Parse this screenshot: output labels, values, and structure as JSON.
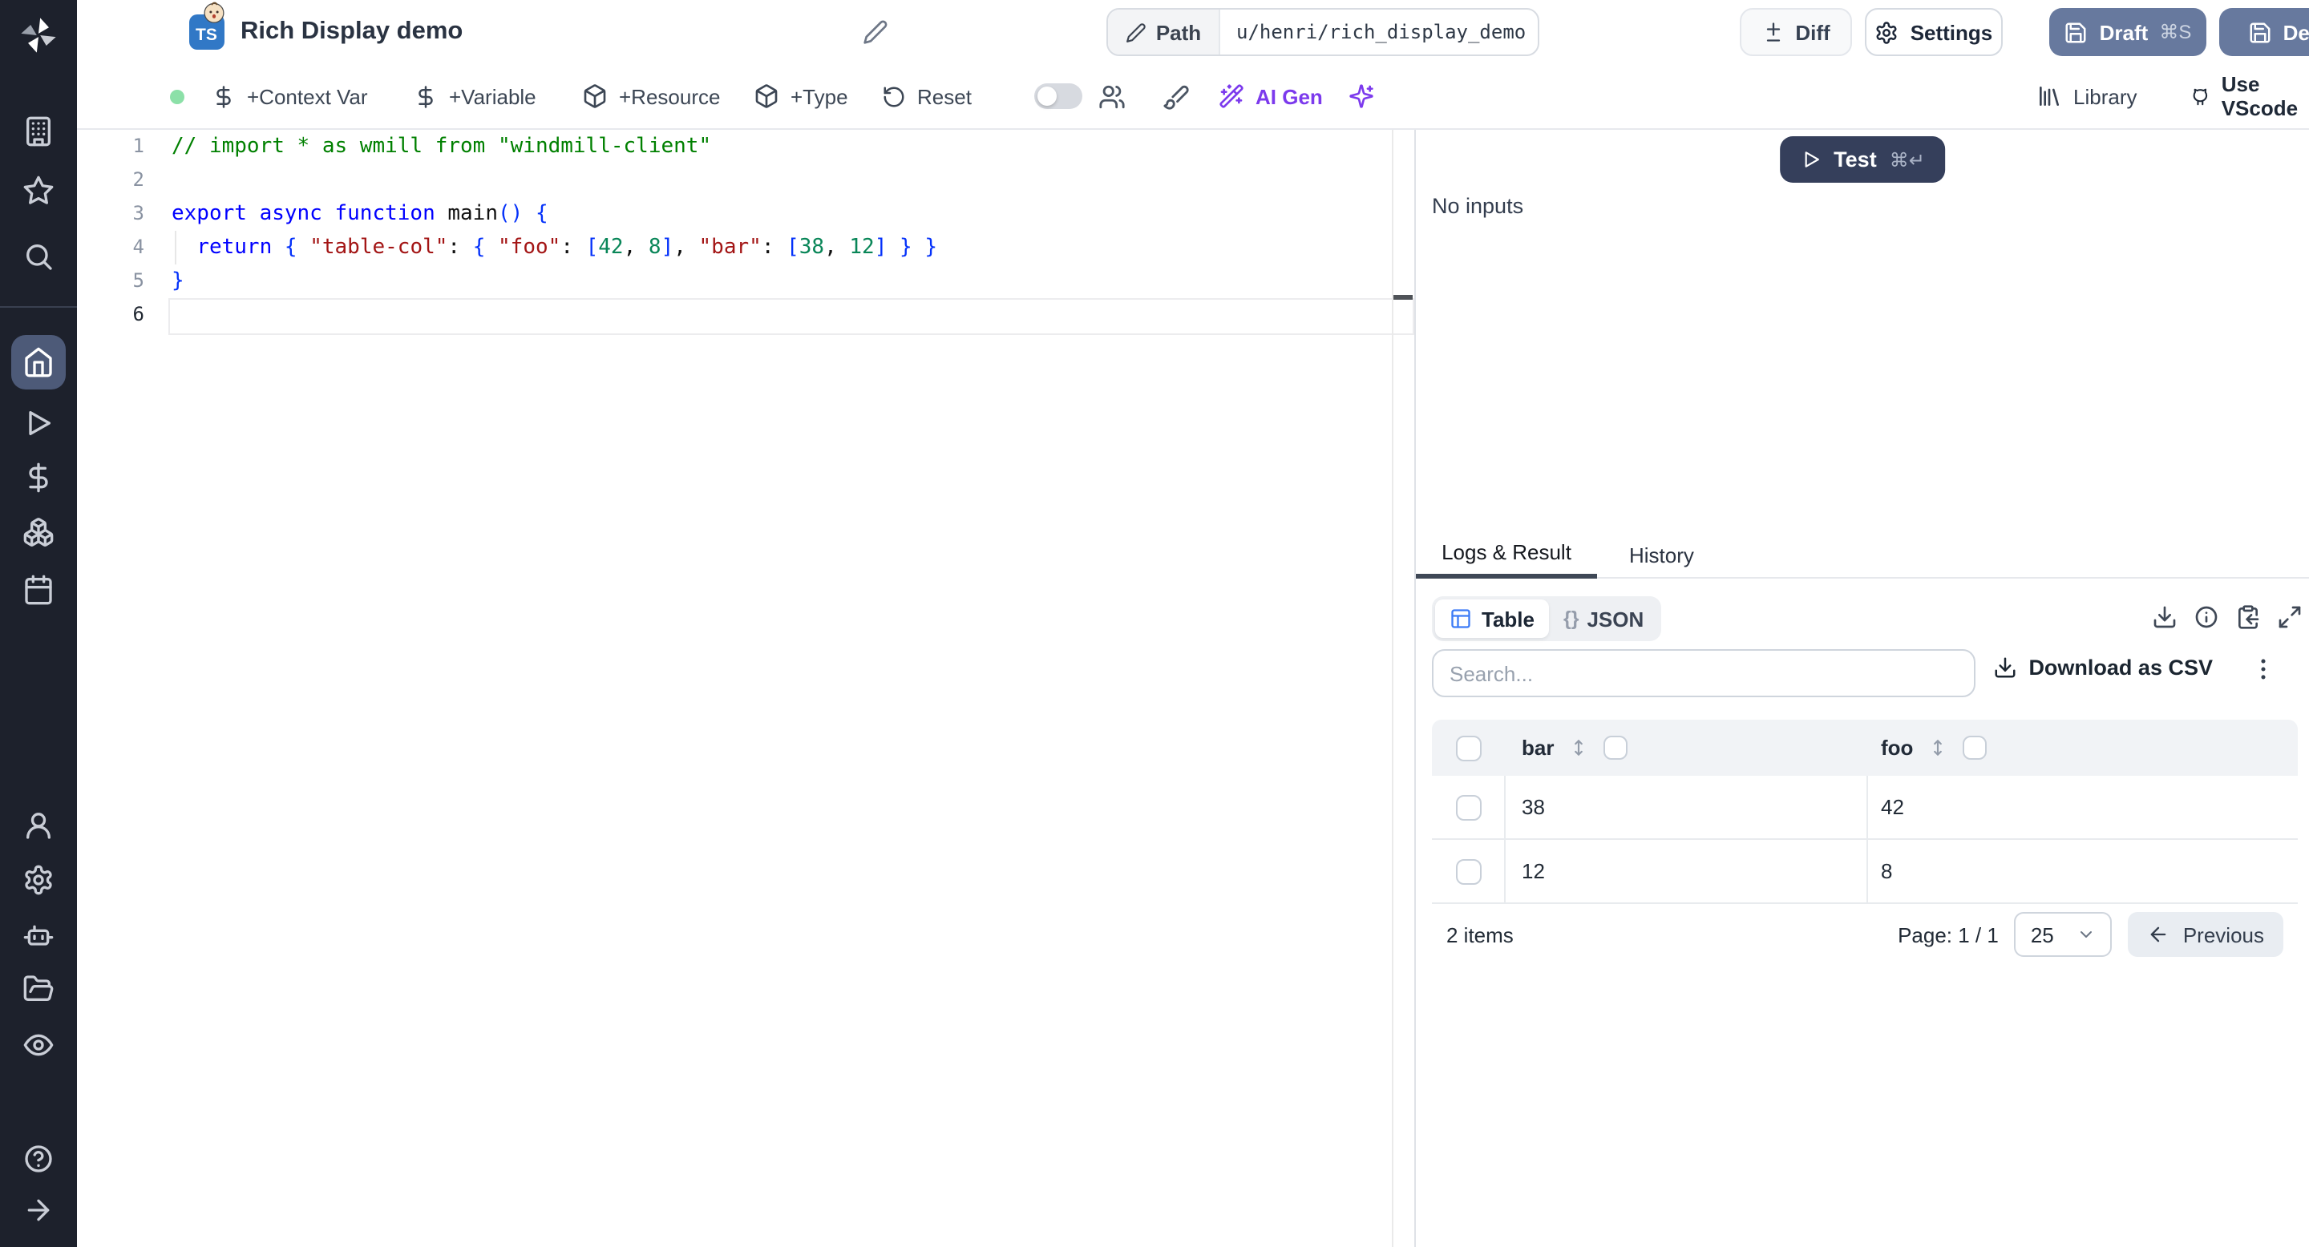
{
  "header": {
    "language_badge": "TS",
    "badge_emoji_icon": "baby-face-emoji",
    "title": "Rich Display demo",
    "path_label": "Path",
    "path_value": "u/henri/rich_display_demo",
    "diff_label": "Diff",
    "settings_label": "Settings",
    "draft_label": "Draft",
    "draft_shortcut": "⌘S",
    "deploy_label": "Deploy"
  },
  "toolbar": {
    "context_var": "+Context Var",
    "variable": "+Variable",
    "resource": "+Resource",
    "type_label": "+Type",
    "reset": "Reset",
    "ai_gen": "AI Gen",
    "library": "Library",
    "use_vscode": "Use VScode"
  },
  "editor": {
    "lines": [
      {
        "n": "1",
        "tokens": [
          {
            "c": "cm",
            "t": "// import * as wmill from \"windmill-client\""
          }
        ]
      },
      {
        "n": "2",
        "tokens": []
      },
      {
        "n": "3",
        "tokens": [
          {
            "c": "kw",
            "t": "export async function "
          },
          {
            "c": "pl",
            "t": "main"
          },
          {
            "c": "br",
            "t": "()"
          },
          {
            "c": "pl",
            "t": " "
          },
          {
            "c": "br",
            "t": "{"
          }
        ]
      },
      {
        "n": "4",
        "tokens": [
          {
            "c": "pl",
            "t": "  "
          },
          {
            "c": "kw",
            "t": "return"
          },
          {
            "c": "pl",
            "t": " "
          },
          {
            "c": "br",
            "t": "{"
          },
          {
            "c": "pl",
            "t": " "
          },
          {
            "c": "str",
            "t": "\"table-col\""
          },
          {
            "c": "pl",
            "t": ": "
          },
          {
            "c": "br",
            "t": "{"
          },
          {
            "c": "pl",
            "t": " "
          },
          {
            "c": "str",
            "t": "\"foo\""
          },
          {
            "c": "pl",
            "t": ": "
          },
          {
            "c": "br",
            "t": "["
          },
          {
            "c": "num",
            "t": "42"
          },
          {
            "c": "pl",
            "t": ", "
          },
          {
            "c": "num",
            "t": "8"
          },
          {
            "c": "br",
            "t": "]"
          },
          {
            "c": "pl",
            "t": ", "
          },
          {
            "c": "str",
            "t": "\"bar\""
          },
          {
            "c": "pl",
            "t": ": "
          },
          {
            "c": "br",
            "t": "["
          },
          {
            "c": "num",
            "t": "38"
          },
          {
            "c": "pl",
            "t": ", "
          },
          {
            "c": "num",
            "t": "12"
          },
          {
            "c": "br",
            "t": "]"
          },
          {
            "c": "pl",
            "t": " "
          },
          {
            "c": "br",
            "t": "}"
          },
          {
            "c": "pl",
            "t": " "
          },
          {
            "c": "br",
            "t": "}"
          }
        ]
      },
      {
        "n": "5",
        "tokens": [
          {
            "c": "br",
            "t": "}"
          }
        ]
      },
      {
        "n": "6",
        "tokens": [],
        "current": true
      }
    ]
  },
  "run_panel": {
    "test_label": "Test",
    "test_shortcut": "⌘↵",
    "no_inputs": "No inputs"
  },
  "result_panel": {
    "tabs": {
      "logs": "Logs & Result",
      "history": "History"
    },
    "view_toggle": {
      "table": "Table",
      "json_braces": "{}",
      "json": "JSON"
    },
    "search_placeholder": "Search...",
    "download_csv": "Download as CSV",
    "table": {
      "columns": [
        "bar",
        "foo"
      ],
      "rows": [
        [
          "38",
          "42"
        ],
        [
          "12",
          "8"
        ]
      ],
      "items_count": "2 items",
      "page_label": "Page: 1 / 1",
      "page_size": "25",
      "previous_label": "Previous"
    }
  },
  "colors": {
    "sidebar_bg": "#1d212c",
    "active_item_bg": "#4d5a78",
    "primary_button": "#67799e",
    "test_button": "#353f5b",
    "badge_blue": "#3178c6",
    "accent_violet": "#7c3aed",
    "status_green": "#8ce0a8",
    "table_icon_blue": "#3c7bf6"
  }
}
